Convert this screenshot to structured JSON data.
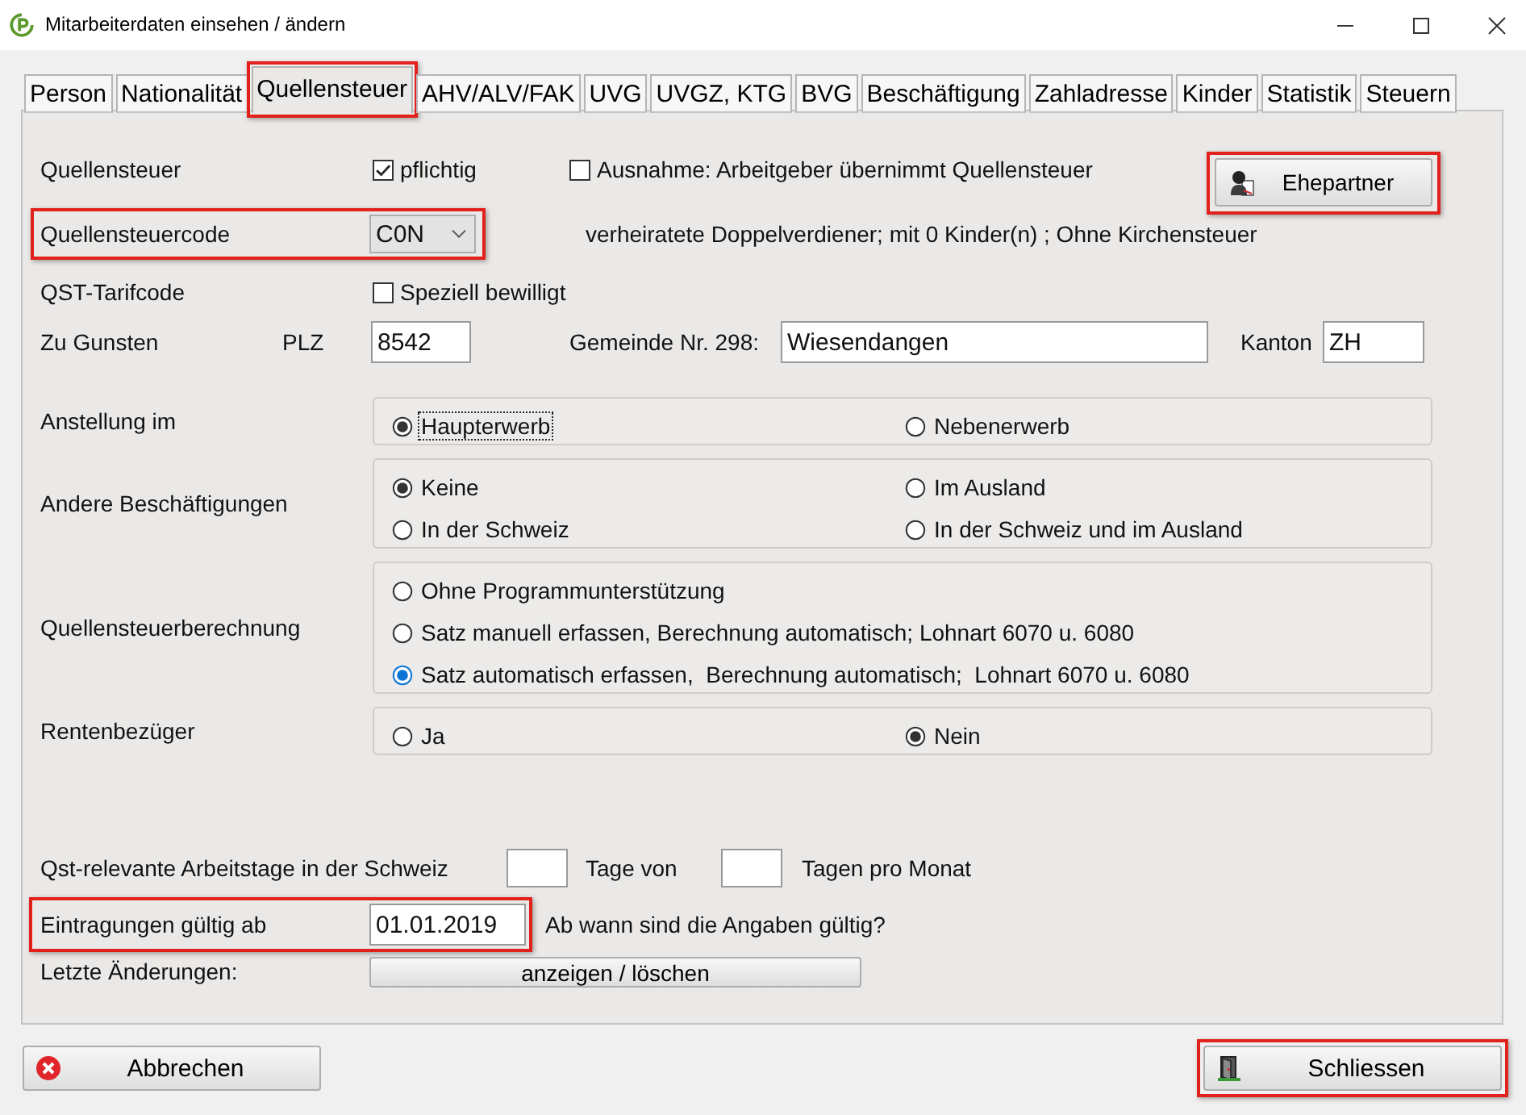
{
  "window": {
    "title": "Mitarbeiterdaten einsehen / ändern"
  },
  "tabs": [
    {
      "label": "Person",
      "selected": false,
      "highlighted": false
    },
    {
      "label": "Nationalität",
      "selected": false,
      "highlighted": false
    },
    {
      "label": "Quellensteuer",
      "selected": true,
      "highlighted": true
    },
    {
      "label": "AHV/ALV/FAK",
      "selected": false,
      "highlighted": false
    },
    {
      "label": "UVG",
      "selected": false,
      "highlighted": false
    },
    {
      "label": "UVGZ, KTG",
      "selected": false,
      "highlighted": false
    },
    {
      "label": "BVG",
      "selected": false,
      "highlighted": false
    },
    {
      "label": "Beschäftigung",
      "selected": false,
      "highlighted": false
    },
    {
      "label": "Zahladresse",
      "selected": false,
      "highlighted": false
    },
    {
      "label": "Kinder",
      "selected": false,
      "highlighted": false
    },
    {
      "label": "Statistik",
      "selected": false,
      "highlighted": false
    },
    {
      "label": "Steuern",
      "selected": false,
      "highlighted": false
    }
  ],
  "quellensteuer": {
    "label": "Quellensteuer",
    "pflichtig": {
      "label": "pflichtig",
      "checked": true
    },
    "ausnahme": {
      "label": "Ausnahme: Arbeitgeber übernimmt Quellensteuer",
      "checked": false
    },
    "ehepartner_button": {
      "label": "Ehepartner",
      "highlighted": true
    }
  },
  "quellensteuercode": {
    "label": "Quellensteuercode",
    "value": "C0N",
    "description": "verheiratete Doppelverdiener; mit 0 Kinder(n) ; Ohne Kirchensteuer",
    "highlighted": true
  },
  "qst_tarifcode": {
    "label": "QST-Tarifcode",
    "speziell_bewilligt": {
      "label": "Speziell bewilligt",
      "checked": false
    }
  },
  "zu_gunsten": {
    "label": "Zu Gunsten",
    "plz_label": "PLZ",
    "plz": "8542",
    "gemeinde_label": "Gemeinde Nr. 298:",
    "gemeinde": "Wiesendangen",
    "kanton_label": "Kanton",
    "kanton": "ZH"
  },
  "option_groups": [
    {
      "label": "Anstellung im",
      "kind": "grid",
      "options": [
        {
          "label": "Haupterwerb",
          "selected": true,
          "focused": true,
          "hovered": false
        },
        {
          "label": "Nebenerwerb",
          "selected": false,
          "focused": false,
          "hovered": false
        }
      ]
    },
    {
      "label": "Andere Beschäftigungen",
      "kind": "grid",
      "options": [
        {
          "label": "Keine",
          "selected": true,
          "focused": false,
          "hovered": false
        },
        {
          "label": "Im Ausland",
          "selected": false,
          "focused": false,
          "hovered": false
        },
        {
          "label": "In der Schweiz",
          "selected": false,
          "focused": false,
          "hovered": false
        },
        {
          "label": "In der Schweiz und im Ausland",
          "selected": false,
          "focused": false,
          "hovered": false
        }
      ]
    },
    {
      "label": "Quellensteuerberechnung",
      "kind": "list",
      "options": [
        {
          "label": "Ohne Programmunterstützung",
          "selected": false,
          "focused": false,
          "hovered": false
        },
        {
          "label": "Satz manuell erfassen, Berechnung automatisch; Lohnart 6070 u. 6080",
          "selected": false,
          "focused": false,
          "hovered": false
        },
        {
          "label": "Satz automatisch erfassen,  Berechnung automatisch;  Lohnart 6070 u. 6080",
          "selected": true,
          "focused": false,
          "hovered": true
        }
      ]
    },
    {
      "label": "Rentenbezüger",
      "kind": "grid",
      "options": [
        {
          "label": "Ja",
          "selected": false,
          "focused": false,
          "hovered": false
        },
        {
          "label": "Nein",
          "selected": true,
          "focused": false,
          "hovered": false
        }
      ]
    }
  ],
  "arbeitstage": {
    "label": "Qst-relevante Arbeitstage in der Schweiz",
    "days_label": "Tage von",
    "month_label": "Tagen pro Monat"
  },
  "gueltig_ab": {
    "label": "Eintragungen gültig ab",
    "value": "01.01.2019",
    "hint": "Ab wann sind die Angaben gültig?",
    "highlighted": true
  },
  "letzte_aenderungen": {
    "label": "Letzte Änderungen:",
    "button": "anzeigen / löschen"
  },
  "footer_buttons": [
    {
      "label": "Abbrechen",
      "kind": "cancel",
      "highlighted": false
    },
    {
      "label": "Schliessen",
      "kind": "close",
      "highlighted": true
    }
  ]
}
